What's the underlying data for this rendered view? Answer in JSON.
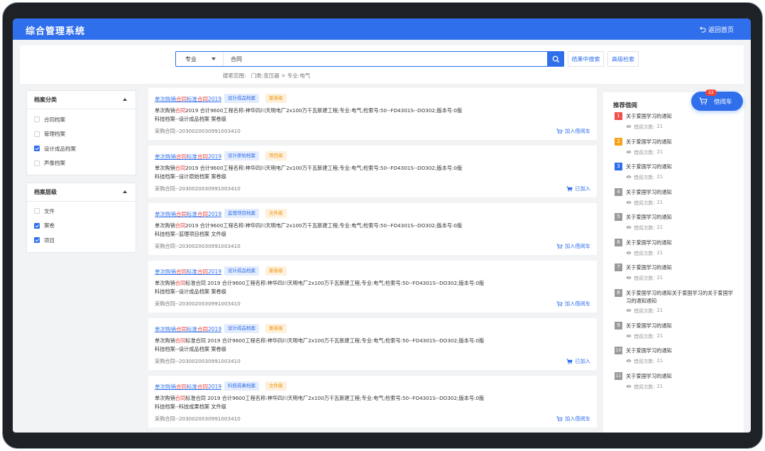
{
  "header": {
    "title": "综合管理系统",
    "back_label": "返回首页"
  },
  "search": {
    "type_selected": "专业",
    "query": "合同",
    "search_in_results_label": "结果中搜索",
    "advanced_label": "高级检索",
    "scope_label": "搜索范围:",
    "scope_path": "门类:变压器 > 专业:电气"
  },
  "filters": {
    "category": {
      "title": "档案分类",
      "items": [
        {
          "label": "合同档案",
          "checked": false
        },
        {
          "label": "管理档案",
          "checked": false
        },
        {
          "label": "设计成品档案",
          "checked": true
        },
        {
          "label": "声像档案",
          "checked": false
        }
      ]
    },
    "level": {
      "title": "档案层级",
      "items": [
        {
          "label": "文件",
          "checked": false
        },
        {
          "label": "案卷",
          "checked": true
        },
        {
          "label": "项目",
          "checked": true
        }
      ]
    }
  },
  "results": [
    {
      "title_pre": "单次购销",
      "title_hl": "合同",
      "title_mid": "标准",
      "title_hl2": "合同",
      "title_post": "2019",
      "tag1": "设计成品档案",
      "tag2": "案卷级",
      "desc_pre": "单次购销",
      "desc_hl": "合同",
      "desc_post": "2019 合计9600工程名称:神华四川天明电厂2x100万千瓦新建工程;专业:电气;检索号:50--FO4301S--DO302;版本号:0版",
      "desc_line2": "科技档案--设计成品档案 案卷级",
      "code": "采购合同--2030020030991003410",
      "action": "加入借阅车"
    },
    {
      "title_pre": "单次购销",
      "title_hl": "合同",
      "title_mid": "标准",
      "title_hl2": "合同",
      "title_post": "2019",
      "tag1": "设计原始档案",
      "tag2": "项目级",
      "desc_pre": "单次购销",
      "desc_hl": "合同",
      "desc_post": "2019 合计9600工程名称:神华四川天明电厂2x100万千瓦新建工程;专业:电气;检索号:50--FO4301S--DO302;版本号:0版",
      "desc_line2": "科技档案--设计原始档案 案卷级",
      "code": "采购合同--2030020030991003410",
      "action": "已加入"
    },
    {
      "title_pre": "单次购销",
      "title_hl": "合同",
      "title_mid": "标准",
      "title_hl2": "合同",
      "title_post": "2019",
      "tag1": "监理项目档案",
      "tag2": "文件级",
      "desc_pre": "单次购销",
      "desc_hl": "合同",
      "desc_post": "2019 合计9600工程名称:神华四川天明电厂2x100万千瓦新建工程;专业:电气;检索号:50--FO4301S--DO302;版本号:0版",
      "desc_line2": "科技档案--监理项目档案 文件级",
      "code": "采购合同--2030020030991003410",
      "action": "加入借阅车"
    },
    {
      "title_pre": "单次购销",
      "title_hl": "合同",
      "title_mid": "标准",
      "title_hl2": "合同",
      "title_post": "2019",
      "tag1": "设计成品档案",
      "tag2": "案卷级",
      "desc_pre": "单次购销",
      "desc_hl": "合同",
      "desc_post": "标准合同 2019 合计9600工程名称:神华四川天明电厂2x100万千瓦新建工程;专业:电气;检索号:50--FO4301S--DO302;版本号:0版",
      "desc_line2": "科技档案--设计成品档案 案卷级",
      "code": "采购合同--2030020030991003410",
      "action": "加入借阅车"
    },
    {
      "title_pre": "单次购销",
      "title_hl": "合同",
      "title_mid": "标准",
      "title_hl2": "合同",
      "title_post": "2019",
      "tag1": "设计成品档案",
      "tag2": "案卷级",
      "desc_pre": "单次购销",
      "desc_hl": "合同",
      "desc_post": "标准合同 2019 合计9600工程名称:神华四川天明电厂2x100万千瓦新建工程;专业:电气;检索号:50--FO4301S--DO302;版本号:0版",
      "desc_line2": "科技档案--设计成品档案 案卷级",
      "code": "采购合同--2030020030991003410",
      "action": "已加入"
    },
    {
      "title_pre": "单次购销",
      "title_hl": "合同",
      "title_mid": "标准",
      "title_hl2": "合同",
      "title_post": "2019",
      "tag1": "科技成果档案",
      "tag2": "文件级",
      "desc_pre": "单次购销",
      "desc_hl": "合同",
      "desc_post": "标准合同 2019 合计9600工程名称:神华四川天明电厂2x100万千瓦新建工程;专业:电气;检索号:50--FO4301S--DO302;版本号:0版",
      "desc_line2": "科技档案--科技成果档案 文件级",
      "code": "采购合同--2030020030991003410",
      "action": "加入借阅车"
    }
  ],
  "recommend": {
    "title": "推荐借阅",
    "count_label": "借阅次数:",
    "items": [
      {
        "rank": "1",
        "text": "关于爱国学习的通知",
        "count": "21",
        "color": "#f0504a"
      },
      {
        "rank": "2",
        "text": "关于爱国学习的通知",
        "count": "21",
        "color": "#f7a21b"
      },
      {
        "rank": "3",
        "text": "关于爱国学习的通知",
        "count": "21",
        "color": "#2f6fec"
      },
      {
        "rank": "4",
        "text": "关于爱国学习的通知",
        "count": "21",
        "color": "#9a9a9a"
      },
      {
        "rank": "5",
        "text": "关于爱国学习的通知",
        "count": "21",
        "color": "#9a9a9a"
      },
      {
        "rank": "6",
        "text": "关于爱国学习的通知",
        "count": "21",
        "color": "#9a9a9a"
      },
      {
        "rank": "7",
        "text": "关于爱国学习的通知",
        "count": "21",
        "color": "#9a9a9a"
      },
      {
        "rank": "8",
        "text": "关于爱国学习的通知关于爱国学习的关于爱国学习的通知通知",
        "count": "21",
        "color": "#9a9a9a"
      },
      {
        "rank": "9",
        "text": "关于爱国学习的通知",
        "count": "21",
        "color": "#9a9a9a"
      },
      {
        "rank": "10",
        "text": "关于爱国学习的通知",
        "count": "21",
        "color": "#9a9a9a"
      },
      {
        "rank": "11",
        "text": "关于爱国学习的通知",
        "count": "21",
        "color": "#9a9a9a"
      }
    ]
  },
  "cart": {
    "label": "借阅车",
    "count": "22"
  }
}
